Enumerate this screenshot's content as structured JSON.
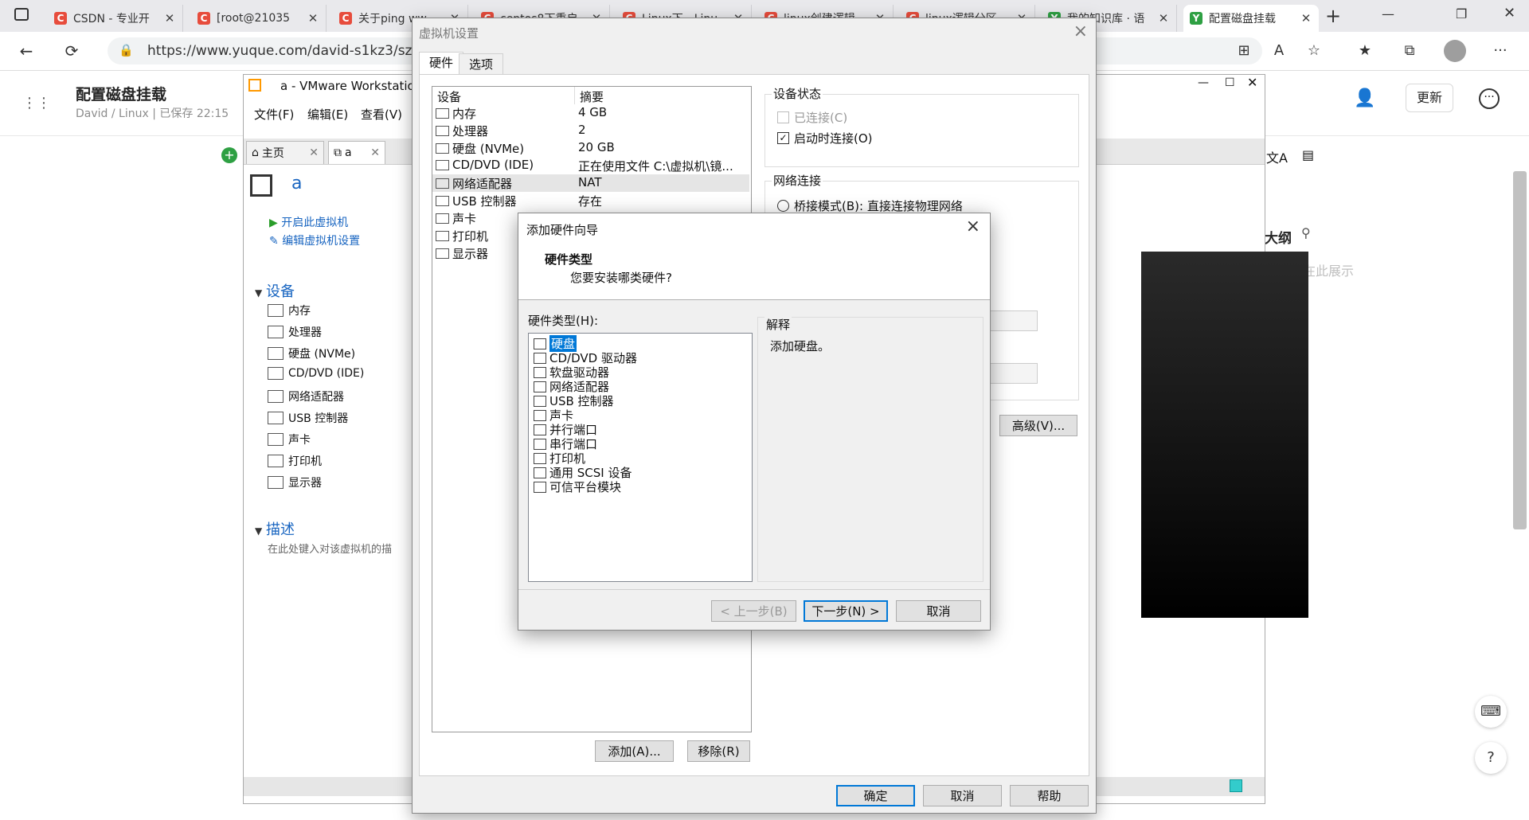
{
  "browser": {
    "tabs": [
      {
        "label": "CSDN - 专业开",
        "favicon": "C"
      },
      {
        "label": "[root@21035",
        "favicon": "C"
      },
      {
        "label": "关于ping ww",
        "favicon": "C"
      },
      {
        "label": "centos8下重启",
        "favicon": "C"
      },
      {
        "label": "Linux下，Linu",
        "favicon": "C"
      },
      {
        "label": "linux创建逻辑",
        "favicon": "C"
      },
      {
        "label": "linux逻辑分区",
        "favicon": "C"
      },
      {
        "label": "我的知识库 · 语",
        "favicon": "Y"
      },
      {
        "label": "配置磁盘挂载",
        "favicon": "Y"
      }
    ],
    "new_tab": "+",
    "url": "https://www.yuque.com/david-s1kz3/szufd"
  },
  "yuque": {
    "doc_title": "配置磁盘挂载",
    "breadcrumb": "David  /  Linux  |  已保存 22:15",
    "update_label": "更新",
    "outline_title": "大纲",
    "outline_hint": "标题将在此展示"
  },
  "vmware": {
    "window_title": "a - VMware Workstation",
    "menu": [
      "文件(F)",
      "编辑(E)",
      "查看(V)"
    ],
    "tabs": [
      {
        "label": "主页"
      },
      {
        "label": "a"
      }
    ],
    "vm_name": "a",
    "actions": [
      "开启此虚拟机",
      "编辑虚拟机设置"
    ],
    "devices_header": "设备",
    "devices": [
      "内存",
      "处理器",
      "硬盘 (NVMe)",
      "CD/DVD (IDE)",
      "网络适配器",
      "USB 控制器",
      "声卡",
      "打印机",
      "显示器"
    ],
    "desc_header": "描述",
    "desc_placeholder": "在此处键入对该虚拟机的描"
  },
  "settings": {
    "title": "虚拟机设置",
    "tabs": [
      "硬件",
      "选项"
    ],
    "col_device": "设备",
    "col_summary": "摘要",
    "devices": [
      {
        "name": "内存",
        "summary": "4 GB"
      },
      {
        "name": "处理器",
        "summary": "2"
      },
      {
        "name": "硬盘 (NVMe)",
        "summary": "20 GB"
      },
      {
        "name": "CD/DVD (IDE)",
        "summary": "正在使用文件 C:\\虚拟机\\镜..."
      },
      {
        "name": "网络适配器",
        "summary": "NAT"
      },
      {
        "name": "USB 控制器",
        "summary": "存在"
      },
      {
        "name": "声卡",
        "summary": ""
      },
      {
        "name": "打印机",
        "summary": ""
      },
      {
        "name": "显示器",
        "summary": ""
      }
    ],
    "selected_device_index": 4,
    "device_status_label": "设备状态",
    "connected_label": "已连接(C)",
    "connect_on_power_label": "启动时连接(O)",
    "connect_on_power_checked": true,
    "net_label": "网络连接",
    "bridged_label": "桥接模式(B): 直接连接物理网络",
    "advanced_button": "高级(V)...",
    "add_button": "添加(A)...",
    "remove_button": "移除(R)",
    "ok_button": "确定",
    "cancel_button": "取消",
    "help_button": "帮助"
  },
  "wizard": {
    "title": "添加硬件向导",
    "heading": "硬件类型",
    "subheading": "您要安装哪类硬件?",
    "list_label": "硬件类型(H):",
    "items": [
      "硬盘",
      "CD/DVD 驱动器",
      "软盘驱动器",
      "网络适配器",
      "USB 控制器",
      "声卡",
      "并行端口",
      "串行端口",
      "打印机",
      "通用 SCSI 设备",
      "可信平台模块"
    ],
    "selected_index": 0,
    "explain_label": "解释",
    "explain_text": "添加硬盘。",
    "back_button": "< 上一步(B)",
    "next_button": "下一步(N) >",
    "cancel_button": "取消"
  },
  "colors": {
    "accent": "#0078d7",
    "link": "#1764c0",
    "csdn_red": "#e74c3c"
  }
}
